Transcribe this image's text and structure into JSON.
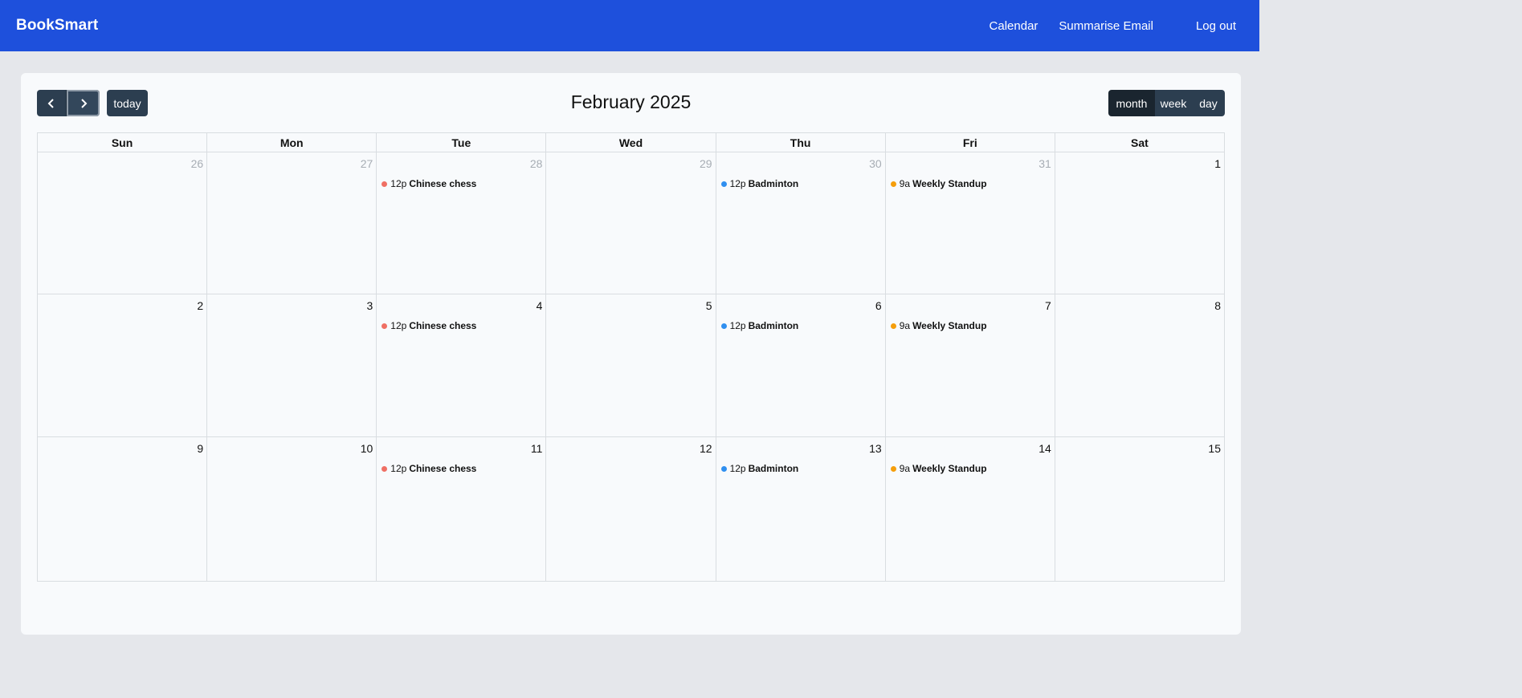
{
  "app": {
    "brand": "BookSmart"
  },
  "nav": {
    "calendar": "Calendar",
    "summarise": "Summarise Email",
    "logout": "Log out"
  },
  "toolbar": {
    "title": "February 2025",
    "today": "today",
    "month": "month",
    "week": "week",
    "day": "day"
  },
  "days_header": [
    "Sun",
    "Mon",
    "Tue",
    "Wed",
    "Thu",
    "Fri",
    "Sat"
  ],
  "weeks": [
    [
      {
        "num": "26",
        "other": true,
        "event": null
      },
      {
        "num": "27",
        "other": true,
        "event": null
      },
      {
        "num": "28",
        "other": true,
        "event": {
          "time": "12p",
          "title": "Chinese chess",
          "color": "#ef6f64"
        }
      },
      {
        "num": "29",
        "other": true,
        "event": null
      },
      {
        "num": "30",
        "other": true,
        "event": {
          "time": "12p",
          "title": "Badminton",
          "color": "#2f8ff0"
        }
      },
      {
        "num": "31",
        "other": true,
        "event": {
          "time": "9a",
          "title": "Weekly Standup",
          "color": "#f59e0b"
        }
      },
      {
        "num": "1",
        "other": false,
        "event": null
      }
    ],
    [
      {
        "num": "2",
        "other": false,
        "event": null
      },
      {
        "num": "3",
        "other": false,
        "event": null
      },
      {
        "num": "4",
        "other": false,
        "event": {
          "time": "12p",
          "title": "Chinese chess",
          "color": "#ef6f64"
        }
      },
      {
        "num": "5",
        "other": false,
        "event": null
      },
      {
        "num": "6",
        "other": false,
        "event": {
          "time": "12p",
          "title": "Badminton",
          "color": "#2f8ff0"
        }
      },
      {
        "num": "7",
        "other": false,
        "event": {
          "time": "9a",
          "title": "Weekly Standup",
          "color": "#f59e0b"
        }
      },
      {
        "num": "8",
        "other": false,
        "event": null
      }
    ],
    [
      {
        "num": "9",
        "other": false,
        "event": null
      },
      {
        "num": "10",
        "other": false,
        "event": null
      },
      {
        "num": "11",
        "other": false,
        "event": {
          "time": "12p",
          "title": "Chinese chess",
          "color": "#ef6f64"
        }
      },
      {
        "num": "12",
        "other": false,
        "event": null
      },
      {
        "num": "13",
        "other": false,
        "event": {
          "time": "12p",
          "title": "Badminton",
          "color": "#2f8ff0"
        }
      },
      {
        "num": "14",
        "other": false,
        "event": {
          "time": "9a",
          "title": "Weekly Standup",
          "color": "#f59e0b"
        }
      },
      {
        "num": "15",
        "other": false,
        "event": null
      }
    ]
  ]
}
